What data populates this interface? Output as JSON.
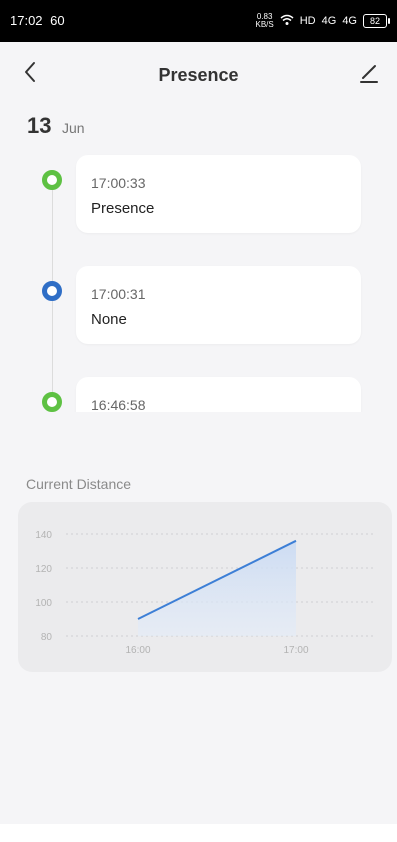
{
  "status_bar": {
    "time": "17:02",
    "indicators": "60",
    "speed_value": "0.83",
    "speed_unit": "KB/S",
    "network": "HD",
    "signal_1": "4G",
    "signal_2": "4G",
    "battery": "82"
  },
  "header": {
    "title": "Presence",
    "back_icon": "chevron-left-icon",
    "edit_icon": "pencil-icon"
  },
  "date": {
    "day": "13",
    "month": "Jun"
  },
  "timeline": [
    {
      "time": "17:00:33",
      "state": "Presence",
      "color": "#5ec143"
    },
    {
      "time": "17:00:31",
      "state": "None",
      "color": "#2f6ec6"
    },
    {
      "time": "16:46:58",
      "state": "",
      "color": "#5ec143"
    }
  ],
  "chart_title": "Current Distance",
  "chart_data": {
    "type": "area",
    "x": [
      "16:00",
      "17:00"
    ],
    "y": [
      90,
      136
    ],
    "x_ticks": [
      "16:00",
      "17:00"
    ],
    "y_ticks": [
      80,
      100,
      120,
      140
    ],
    "ylim": [
      80,
      140
    ],
    "line_color": "#3d7fd6",
    "grid": true
  }
}
